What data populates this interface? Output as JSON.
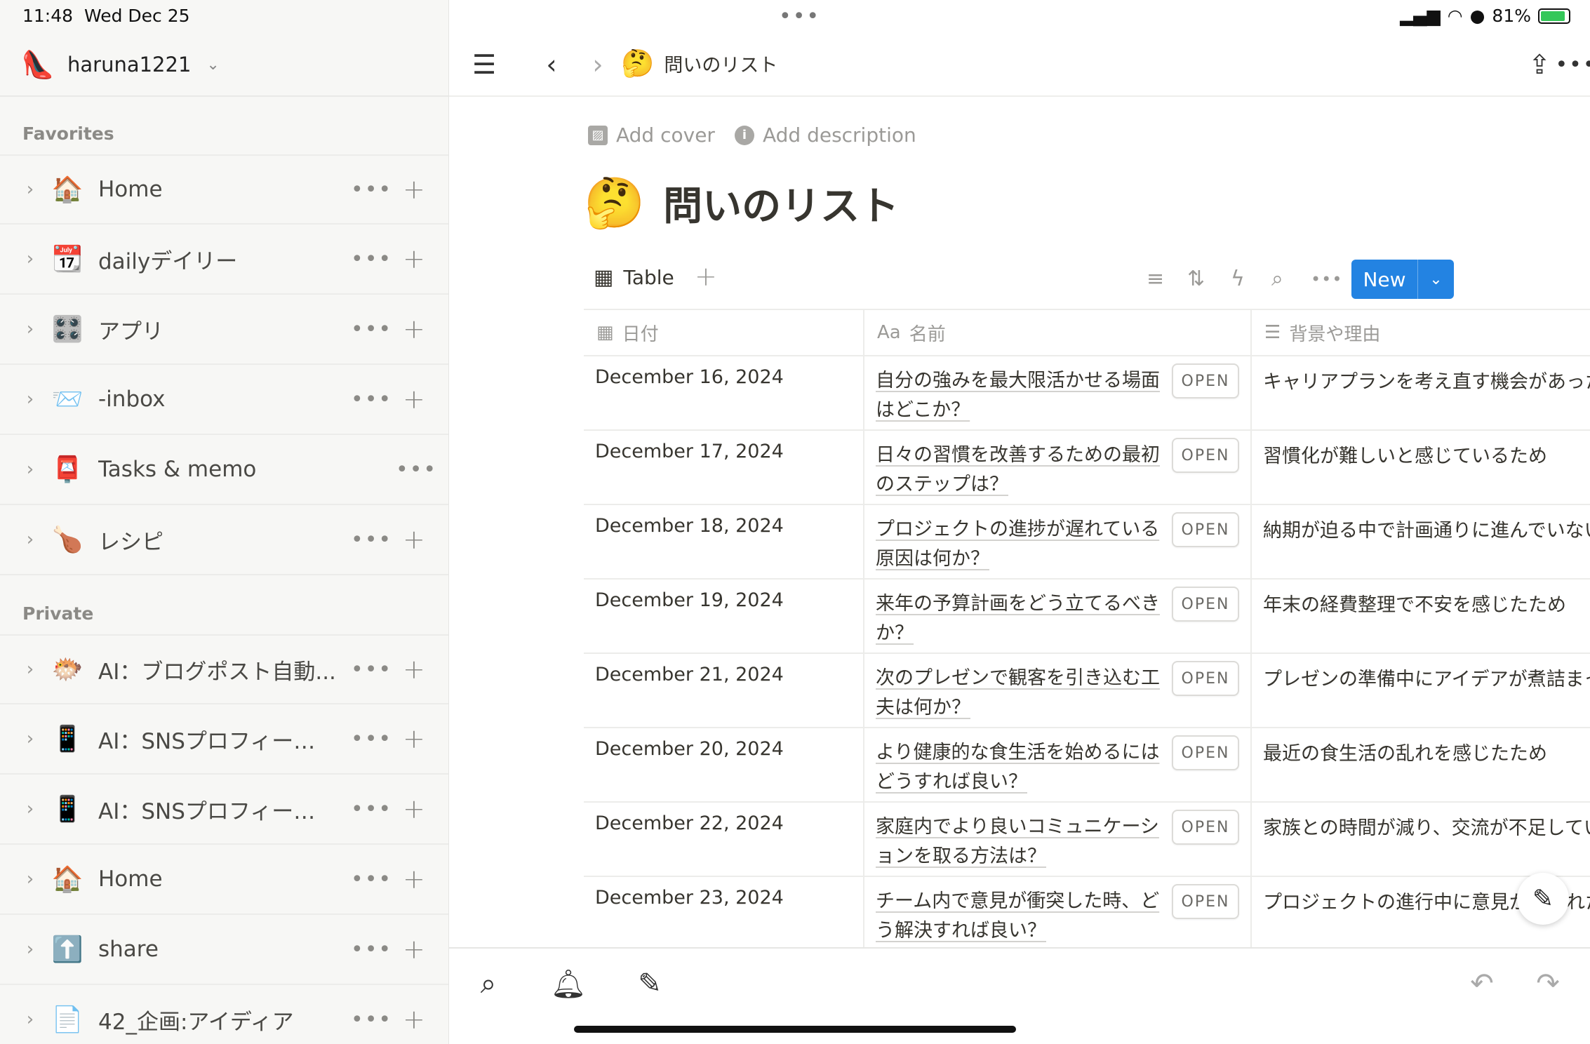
{
  "status": {
    "time": "11:48",
    "date": "Wed Dec 25",
    "battery": "81%"
  },
  "workspace": {
    "emoji": "👠",
    "name": "haruna1221"
  },
  "sidebar": {
    "favorites_label": "Favorites",
    "favorites": [
      {
        "emoji": "🏠",
        "label": "Home"
      },
      {
        "emoji": "📆",
        "label": "dailyデイリー"
      },
      {
        "emoji": "🎛️",
        "label": "アプリ"
      },
      {
        "emoji": "📨",
        "label": "-inbox"
      },
      {
        "emoji": "📮",
        "label": "Tasks & memo"
      },
      {
        "emoji": "🍗",
        "label": "レシピ"
      }
    ],
    "private_label": "Private",
    "private": [
      {
        "emoji": "🐡",
        "label": "AI：ブログポスト自動..."
      },
      {
        "emoji": "📱",
        "label": "AI：SNSプロフィール案"
      },
      {
        "emoji": "📱",
        "label": "AI：SNSプロフィール案"
      },
      {
        "emoji": "🏠",
        "label": "Home"
      },
      {
        "emoji": "⬆️",
        "label": "share"
      },
      {
        "emoji": "📄",
        "label": "42_企画:アイディア"
      }
    ]
  },
  "breadcrumb": {
    "emoji": "🤔",
    "title": "問いのリスト"
  },
  "page": {
    "add_cover": "Add cover",
    "add_description": "Add description",
    "emoji": "🤔",
    "title": "問いのリスト"
  },
  "view": {
    "tab_label": "Table",
    "new_label": "New"
  },
  "table": {
    "headers": {
      "date": "日付",
      "name": "名前",
      "name_prefix": "Aa",
      "reason": "背景や理由"
    },
    "open_label": "OPEN",
    "rows": [
      {
        "date": "December 16, 2024",
        "name": "自分の強みを最大限活かせる場面はどこか？",
        "reason": "キャリアプランを考え直す機会があった"
      },
      {
        "date": "December 17, 2024",
        "name": "日々の習慣を改善するための最初のステップは？",
        "reason": "習慣化が難しいと感じているため"
      },
      {
        "date": "December 18, 2024",
        "name": "プロジェクトの進捗が遅れている原因は何か？",
        "reason": "納期が迫る中で計画通りに進んでいない"
      },
      {
        "date": "December 19, 2024",
        "name": "来年の予算計画をどう立てるべきか？",
        "reason": "年末の経費整理で不安を感じたため"
      },
      {
        "date": "December 21, 2024",
        "name": "次のプレゼンで観客を引き込む工夫は何か？",
        "reason": "プレゼンの準備中にアイデアが煮詰まった"
      },
      {
        "date": "December 20, 2024",
        "name": "より健康的な食生活を始めるにはどうすれば良い？",
        "reason": "最近の食生活の乱れを感じたため"
      },
      {
        "date": "December 22, 2024",
        "name": "家庭内でより良いコミュニケーションを取る方法は？",
        "reason": "家族との時間が減り、交流が不足している"
      },
      {
        "date": "December 23, 2024",
        "name": "チーム内で意見が衝突した時、どう解決すれば良い？",
        "reason": "プロジェクトの進行中に意見が分かれた"
      }
    ]
  }
}
